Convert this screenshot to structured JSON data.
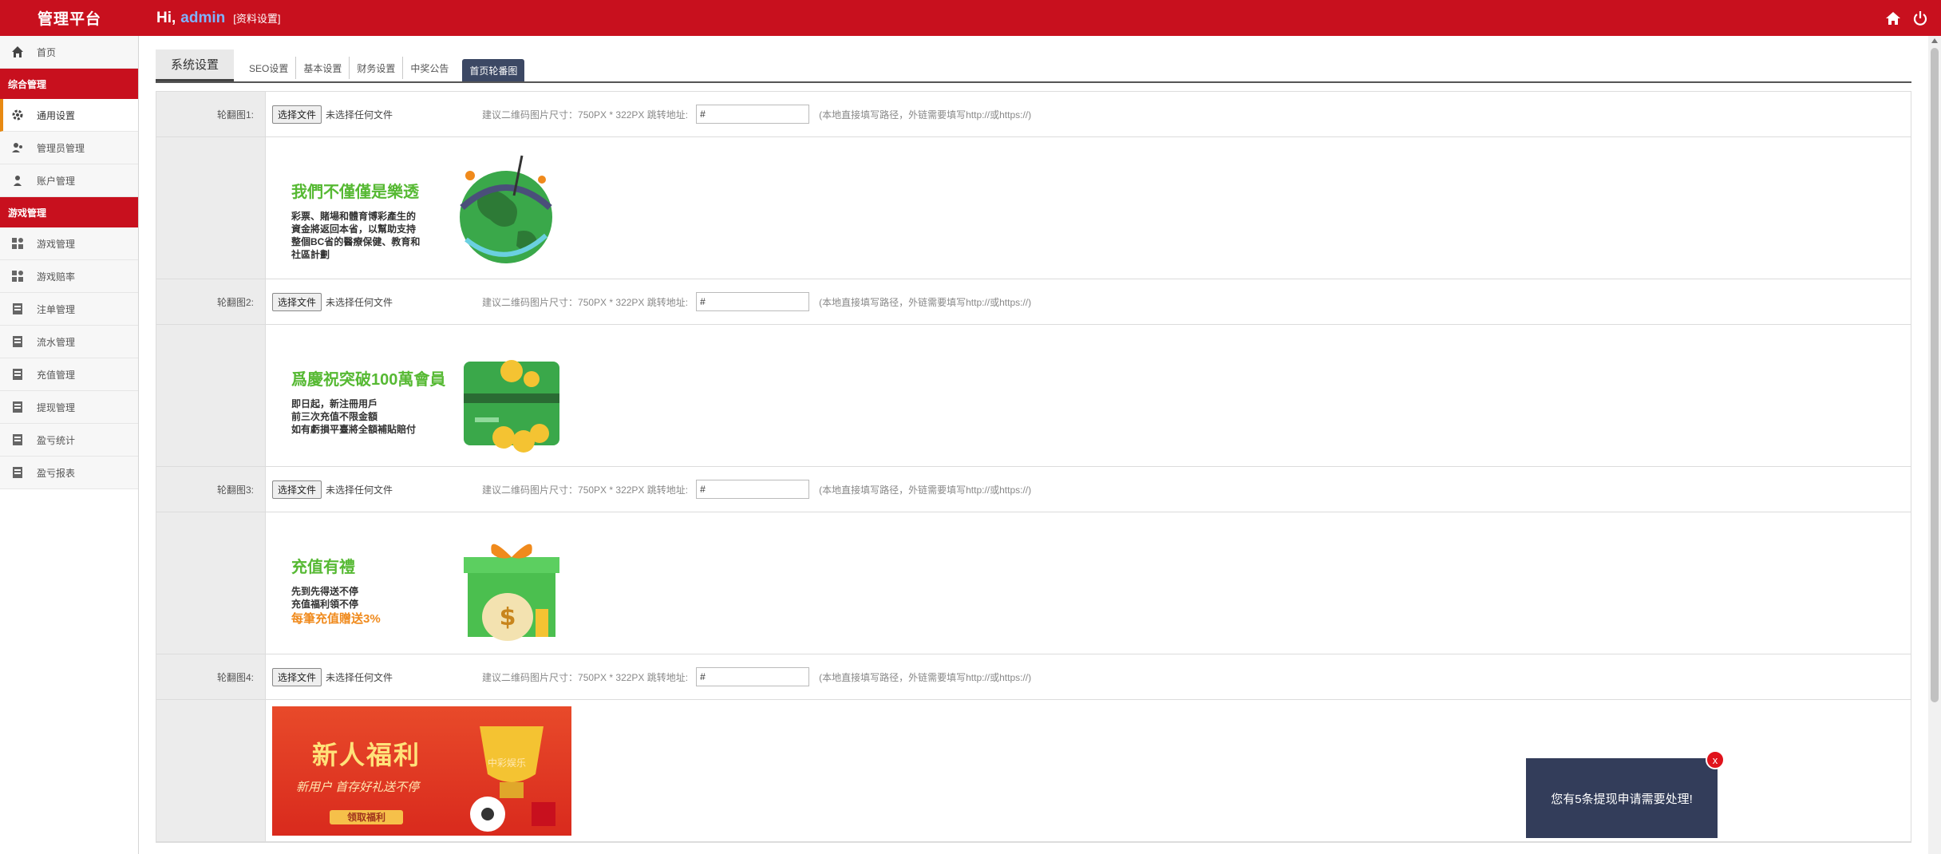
{
  "header": {
    "brand": "管理平台",
    "greeting": "Hi,",
    "username": "admin",
    "profile_link": "[资料设置]",
    "bg_color": "#c8101e"
  },
  "sidebar": {
    "home": "首页",
    "section1": "综合管理",
    "items1": [
      "通用设置",
      "管理员管理",
      "账户管理"
    ],
    "section2": "游戏管理",
    "items2": [
      "游戏管理",
      "游戏赔率",
      "注单管理",
      "流水管理",
      "充值管理",
      "提现管理",
      "盈亏统计",
      "盈亏报表"
    ]
  },
  "tabs": {
    "primary": "系统设置",
    "sub": [
      "SEO设置",
      "基本设置",
      "财务设置",
      "中奖公告",
      "首页轮番图"
    ],
    "active": "首页轮番图"
  },
  "rows": [
    {
      "label": "轮翻图1:",
      "button": "选择文件",
      "file_status": "未选择任何文件",
      "hint": "建议二维码图片尺寸：750PX * 322PX 跳转地址:",
      "link_value": "#",
      "note": "(本地直接填写路径，外链需要填写http://或https://)"
    },
    {
      "label": "轮翻图2:",
      "button": "选择文件",
      "file_status": "未选择任何文件",
      "hint": "建议二维码图片尺寸：750PX * 322PX 跳转地址:",
      "link_value": "#",
      "note": "(本地直接填写路径，外链需要填写http://或https://)"
    },
    {
      "label": "轮翻图3:",
      "button": "选择文件",
      "file_status": "未选择任何文件",
      "hint": "建议二维码图片尺寸：750PX * 322PX 跳转地址:",
      "link_value": "#",
      "note": "(本地直接填写路径，外链需要填写http://或https://)"
    },
    {
      "label": "轮翻图4:",
      "button": "选择文件",
      "file_status": "未选择任何文件",
      "hint": "建议二维码图片尺寸：750PX * 322PX 跳转地址:",
      "link_value": "#",
      "note": "(本地直接填写路径，外链需要填写http://或https://)"
    }
  ],
  "banners": {
    "b1": {
      "title": "我們不僅僅是樂透",
      "lines": [
        "彩票、賭場和體育博彩產生的",
        "資金將返回本省，以幫助支持",
        "整個BC省的醫療保健、教育和",
        "社區計劃"
      ]
    },
    "b2": {
      "title": "爲慶祝突破100萬會員",
      "lines": [
        "即日起，新注冊用戶",
        "前三次充值不限金額",
        "如有虧損平臺將全額補貼賠付"
      ]
    },
    "b3": {
      "title": "充值有禮",
      "lines": [
        "先到先得送不停",
        "充值福利領不停"
      ],
      "highlight": "每筆充值贈送3%"
    },
    "b4": {
      "title": "新人福利",
      "sub": "新用户 首存好礼送不停",
      "button": "领取福利",
      "brand": "中彩娱乐"
    }
  },
  "notification": {
    "text": "您有5条提现申请需要处理!",
    "close": "x"
  },
  "icons": {
    "home": "home-icon",
    "power": "power-icon",
    "gear": "gear-icon",
    "users": "users-icon",
    "user": "user-icon",
    "apps": "apps-icon",
    "ledger": "ledger-icon"
  }
}
